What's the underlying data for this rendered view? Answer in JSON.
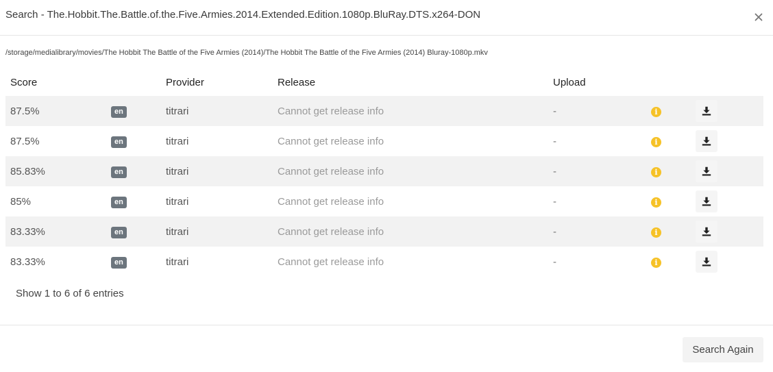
{
  "modal": {
    "title": "Search - The.Hobbit.The.Battle.of.the.Five.Armies.2014.Extended.Edition.1080p.BluRay.DTS.x264-DON",
    "close_icon": "close-icon",
    "file_path": "/storage/medialibrary/movies/The Hobbit The Battle of the Five Armies (2014)/The Hobbit The Battle of the Five Armies (2014) Bluray-1080p.mkv"
  },
  "table": {
    "headers": {
      "score": "Score",
      "lang": "",
      "provider": "Provider",
      "release": "Release",
      "upload": "Upload",
      "info": "",
      "action": ""
    },
    "rows": [
      {
        "score": "87.5%",
        "lang": "en",
        "provider": "titrari",
        "release": "Cannot get release info",
        "upload": "-"
      },
      {
        "score": "87.5%",
        "lang": "en",
        "provider": "titrari",
        "release": "Cannot get release info",
        "upload": "-"
      },
      {
        "score": "85.83%",
        "lang": "en",
        "provider": "titrari",
        "release": "Cannot get release info",
        "upload": "-"
      },
      {
        "score": "85%",
        "lang": "en",
        "provider": "titrari",
        "release": "Cannot get release info",
        "upload": "-"
      },
      {
        "score": "83.33%",
        "lang": "en",
        "provider": "titrari",
        "release": "Cannot get release info",
        "upload": "-"
      },
      {
        "score": "83.33%",
        "lang": "en",
        "provider": "titrari",
        "release": "Cannot get release info",
        "upload": "-"
      }
    ],
    "info_icon": "info-circle-icon",
    "action_icon": "download-icon",
    "info_glyph": "i"
  },
  "footer": {
    "entries_text": "Show 1 to 6 of 6 entries",
    "search_again_label": "Search Again"
  },
  "colors": {
    "badge": "#6c757d",
    "info_icon": "#f6c227",
    "row_stripe": "#f2f2f2",
    "release_text": "#9a9a9a"
  }
}
